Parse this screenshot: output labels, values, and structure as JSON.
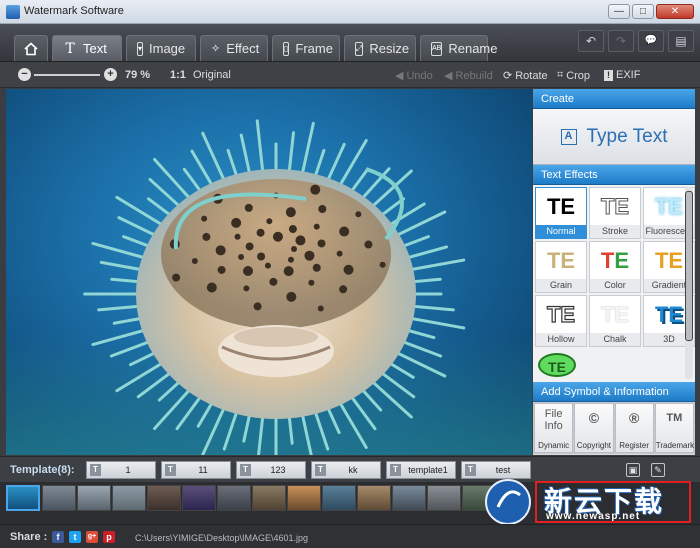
{
  "window": {
    "title": "Watermark Software",
    "btn_min": "—",
    "btn_max": "□",
    "btn_close": "✕"
  },
  "tabs": [
    {
      "label": "",
      "icon": "home-icon"
    },
    {
      "label": "Text",
      "icon": "text-icon",
      "active": true
    },
    {
      "label": "Image",
      "icon": "image-icon"
    },
    {
      "label": "Effect",
      "icon": "wand-icon"
    },
    {
      "label": "Frame",
      "icon": "frame-icon"
    },
    {
      "label": "Resize",
      "icon": "resize-icon"
    },
    {
      "label": "Rename",
      "icon": "rename-icon"
    }
  ],
  "right_tools": [
    "↶",
    "↷",
    "💬",
    "▤"
  ],
  "toolbar": {
    "zoom_value": "79 %",
    "original_label": "Original",
    "original_glyph": "1:1",
    "undo_label": "Undo",
    "rebuild_label": "Rebuild",
    "rotate_label": "Rotate",
    "crop_label": "Crop",
    "exif_label": "EXIF"
  },
  "panel": {
    "create_header": "Create",
    "type_text_label": "Type Text",
    "type_text_glyph": "A",
    "effects_header": "Text Effects",
    "effects": [
      {
        "label": "Normal",
        "glyph": "TE",
        "color": "#000000",
        "selected": true
      },
      {
        "label": "Stroke",
        "glyph": "TE",
        "color": "#9a9a9a"
      },
      {
        "label": "Fluorescent",
        "glyph": "TE",
        "color": "#7fd3f0"
      },
      {
        "label": "Grain",
        "glyph": "TE",
        "color": "#c9b27a"
      },
      {
        "label": "Color",
        "glyph": "TE",
        "color": "#e04030"
      },
      {
        "label": "Gradient",
        "glyph": "TE",
        "color": "#e8a020"
      },
      {
        "label": "Hollow",
        "glyph": "TE",
        "color": "#555555"
      },
      {
        "label": "Chalk",
        "glyph": "TE",
        "color": "#dddddd"
      },
      {
        "label": "3D",
        "glyph": "TE",
        "color": "#1e88d0"
      },
      {
        "label": "",
        "glyph": "TE",
        "color": "#2a7a2a"
      }
    ],
    "symbol_header": "Add Symbol & Information",
    "symbols": [
      {
        "label": "Dynamic",
        "glyph": "File Info"
      },
      {
        "label": "Copyright",
        "glyph": "©"
      },
      {
        "label": "Register",
        "glyph": "®"
      },
      {
        "label": "Trademark",
        "glyph": "TM"
      }
    ]
  },
  "templates": {
    "label": "Template(8):",
    "icon_glyph": "T",
    "items": [
      "1",
      "11",
      "123",
      "kk",
      "template1",
      "test"
    ],
    "save_glyph": "▣",
    "edit_glyph": "✎"
  },
  "status": {
    "share_label": "Share :",
    "socials": [
      {
        "name": "facebook",
        "glyph": "f",
        "color": "#3b5998"
      },
      {
        "name": "twitter",
        "glyph": "t",
        "color": "#1da1f2"
      },
      {
        "name": "googleplus",
        "glyph": "g+",
        "color": "#dd4b39"
      },
      {
        "name": "pinterest",
        "glyph": "p",
        "color": "#cb2027"
      }
    ],
    "path": "C:\\Users\\YIMIGE\\Desktop\\IMAGE\\4601.jpg"
  },
  "watermark": {
    "text": "新云下载",
    "url": "www.newasp.net"
  }
}
